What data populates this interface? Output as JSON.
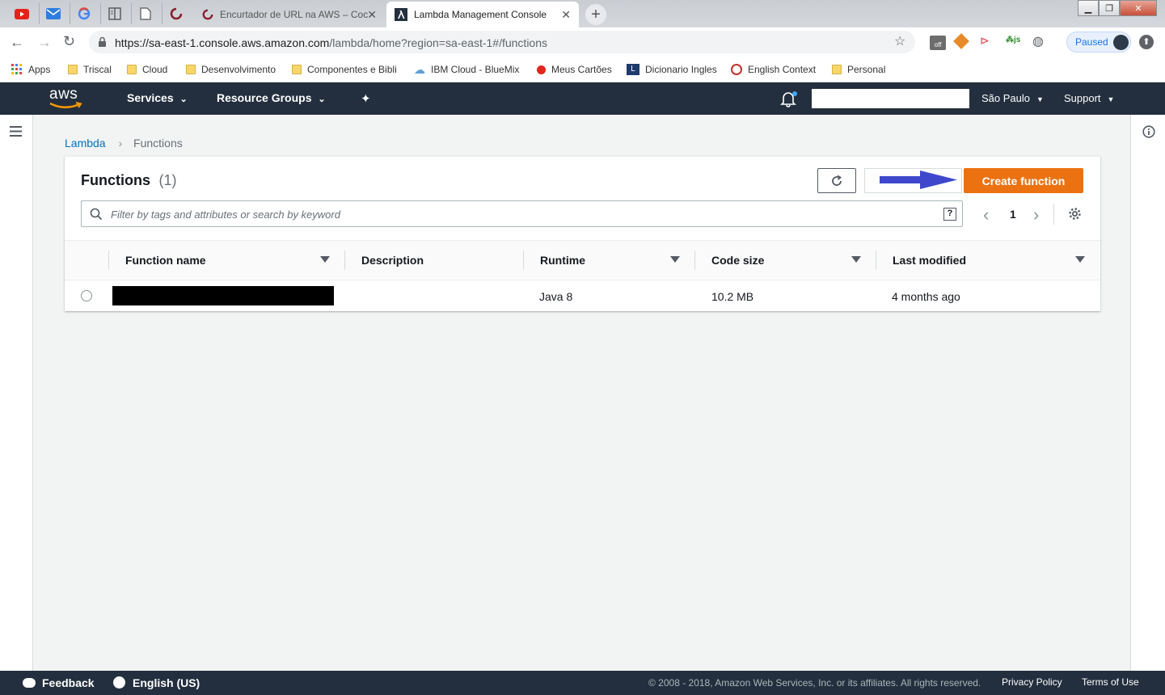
{
  "browser": {
    "tabs": [
      {
        "title": "Encurtador de URL na AWS – Coc"
      },
      {
        "title": "Lambda Management Console"
      }
    ],
    "url_host": "https://sa-east-1.console.aws.amazon.com",
    "url_path": "/lambda/home?region=sa-east-1#/functions",
    "profile_status": "Paused",
    "bookmarks": [
      "Apps",
      "Triscal",
      "Cloud",
      "Desenvolvimento",
      "Componentes e Bibli",
      "IBM Cloud - BlueMix",
      "Meus Cartões",
      "Dicionario Ingles",
      "English Context",
      "Personal"
    ]
  },
  "aws_nav": {
    "logo": "aws",
    "services": "Services",
    "resource_groups": "Resource Groups",
    "region": "São Paulo",
    "support": "Support"
  },
  "breadcrumb": {
    "root": "Lambda",
    "current": "Functions"
  },
  "functions_panel": {
    "title": "Functions",
    "count": "(1)",
    "create_label": "Create function",
    "search_placeholder": "Filter by tags and attributes or search by keyword",
    "page": "1",
    "columns": [
      "Function name",
      "Description",
      "Runtime",
      "Code size",
      "Last modified"
    ],
    "rows": [
      {
        "name": "",
        "description": "",
        "runtime": "Java 8",
        "code_size": "10.2 MB",
        "last_modified": "4 months ago"
      }
    ]
  },
  "footer": {
    "feedback": "Feedback",
    "language": "English (US)",
    "copyright": "© 2008 - 2018, Amazon Web Services, Inc. or its affiliates. All rights reserved.",
    "privacy": "Privacy Policy",
    "terms": "Terms of Use"
  },
  "colors": {
    "aws_nav": "#232f3e",
    "primary_button": "#ec7211",
    "link": "#0073bb",
    "annotation_arrow": "#3f48cc"
  }
}
